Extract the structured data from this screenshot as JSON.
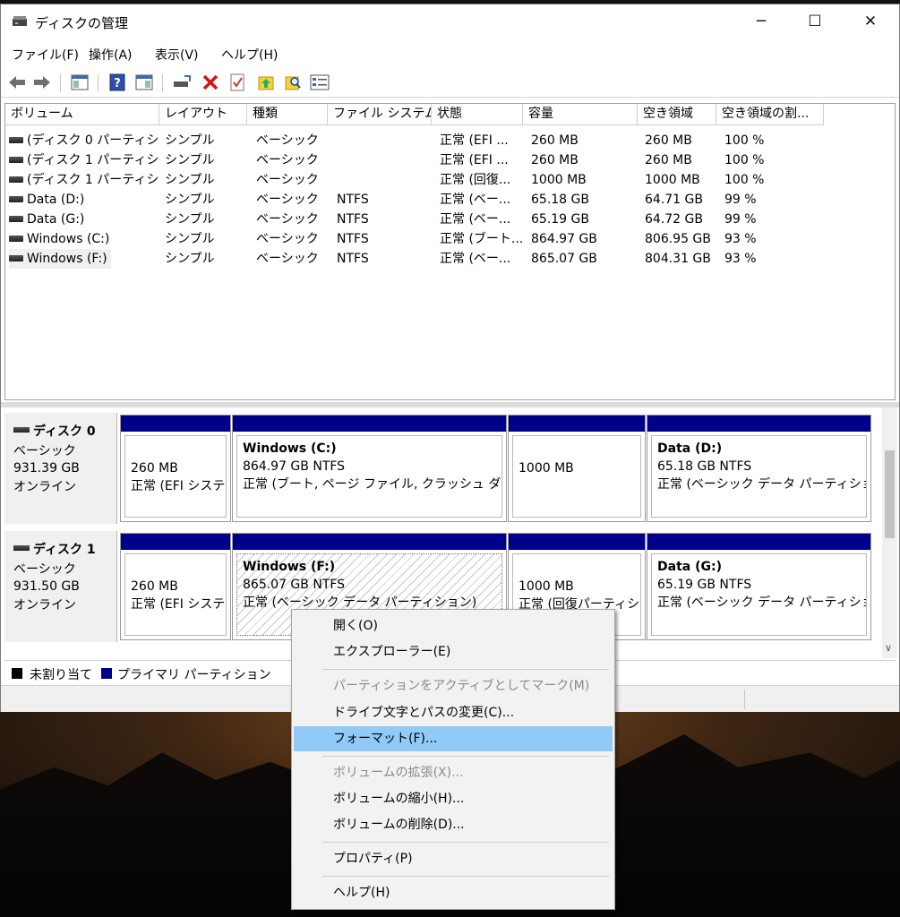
{
  "window": {
    "title": "ディスクの管理",
    "minimize_glyph": "─",
    "maximize_glyph": "☐",
    "close_glyph": "✕"
  },
  "menu": [
    "ファイル(F)",
    "操作(A)",
    "表示(V)",
    "ヘルプ(H)"
  ],
  "toolbar_icons": [
    "back-arrow-icon",
    "forward-arrow-icon",
    "properties-panel-icon",
    "help-icon",
    "view-panel-icon",
    "connect-icon",
    "delete-icon",
    "check-icon",
    "folder-up-icon",
    "search-icon",
    "list-icon"
  ],
  "volumes": {
    "columns": [
      "ボリューム",
      "レイアウト",
      "種類",
      "ファイル システム",
      "状態",
      "容量",
      "空き領域",
      "空き領域の割..."
    ],
    "rows": [
      [
        "(ディスク 0 パーティシ...",
        "シンプル",
        "ベーシック",
        "",
        "正常 (EFI ...",
        "260 MB",
        "260 MB",
        "100 %"
      ],
      [
        "(ディスク 1 パーティシ...",
        "シンプル",
        "ベーシック",
        "",
        "正常 (EFI ...",
        "260 MB",
        "260 MB",
        "100 %"
      ],
      [
        "(ディスク 1 パーティシ...",
        "シンプル",
        "ベーシック",
        "",
        "正常 (回復...",
        "1000 MB",
        "1000 MB",
        "100 %"
      ],
      [
        "Data (D:)",
        "シンプル",
        "ベーシック",
        "NTFS",
        "正常 (ベー...",
        "65.18 GB",
        "64.71 GB",
        "99 %"
      ],
      [
        "Data (G:)",
        "シンプル",
        "ベーシック",
        "NTFS",
        "正常 (ベー...",
        "65.19 GB",
        "64.72 GB",
        "99 %"
      ],
      [
        "Windows (C:)",
        "シンプル",
        "ベーシック",
        "NTFS",
        "正常 (ブート...",
        "864.97 GB",
        "806.95 GB",
        "93 %"
      ],
      [
        "Windows (F:)",
        "シンプル",
        "ベーシック",
        "NTFS",
        "正常 (ベー...",
        "865.07 GB",
        "804.31 GB",
        "93 %"
      ]
    ],
    "selected_row": 6
  },
  "disks": [
    {
      "name": "ディスク 0",
      "type": "ベーシック",
      "size": "931.39 GB",
      "status": "オンライン",
      "partitions": [
        {
          "name": "",
          "size": "260 MB",
          "status": "正常 (EFI システ"
        },
        {
          "name": "Windows  (C:)",
          "size": "864.97 GB NTFS",
          "status": "正常 (ブート, ページ ファイル, クラッシュ ダンプ, /"
        },
        {
          "name": "",
          "size": "1000 MB",
          "status": ""
        },
        {
          "name": "Data  (D:)",
          "size": "65.18 GB NTFS",
          "status": "正常 (ベーシック データ パーティション)"
        }
      ]
    },
    {
      "name": "ディスク 1",
      "type": "ベーシック",
      "size": "931.50 GB",
      "status": "オンライン",
      "partitions": [
        {
          "name": "",
          "size": "260 MB",
          "status": "正常 (EFI システ"
        },
        {
          "name": "Windows  (F:)",
          "size": "865.07 GB NTFS",
          "status": "正常 (ベーシック データ パーティション)"
        },
        {
          "name": "",
          "size": "1000 MB",
          "status": "正常 (回復パーティシ"
        },
        {
          "name": "Data  (G:)",
          "size": "65.19 GB NTFS",
          "status": "正常 (ベーシック データ パーティション)"
        }
      ]
    }
  ],
  "legend": {
    "unallocated": "未割り当て",
    "primary": "プライマリ パーティション",
    "unallocated_color": "#000000",
    "primary_color": "#00008b"
  },
  "context_menu": {
    "items": [
      {
        "label": "開く(O)",
        "enabled": true
      },
      {
        "label": "エクスプローラー(E)",
        "enabled": true
      },
      {
        "label": "パーティションをアクティブとしてマーク(M)",
        "enabled": false
      },
      {
        "label": "ドライブ文字とパスの変更(C)...",
        "enabled": true
      },
      {
        "label": "フォーマット(F)...",
        "enabled": true,
        "highlighted": true
      },
      {
        "label": "ボリュームの拡張(X)...",
        "enabled": false
      },
      {
        "label": "ボリュームの縮小(H)...",
        "enabled": true
      },
      {
        "label": "ボリュームの削除(D)...",
        "enabled": true
      },
      {
        "label": "プロパティ(P)",
        "enabled": true
      },
      {
        "label": "ヘルプ(H)",
        "enabled": true
      }
    ]
  },
  "colors": {
    "partition_bar": "#00008b",
    "menu_highlight": "#91c9f7"
  }
}
